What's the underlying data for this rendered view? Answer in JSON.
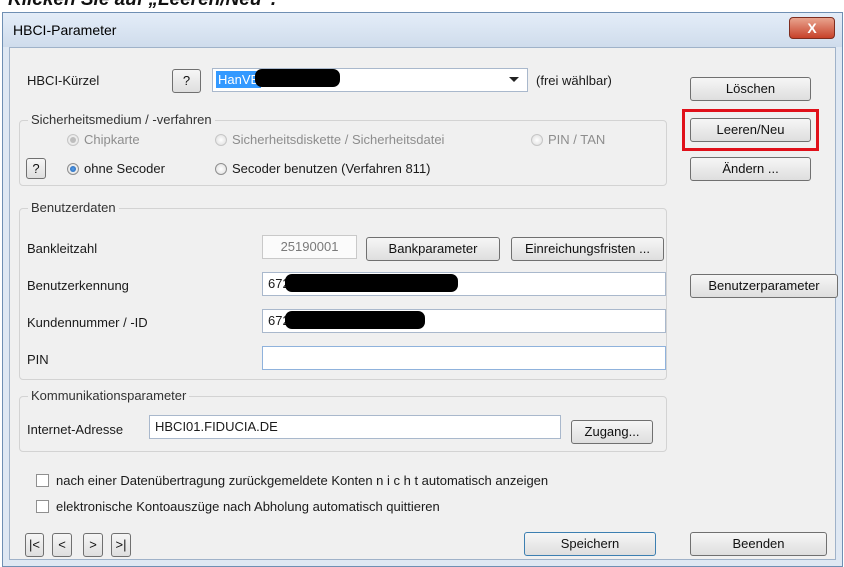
{
  "caption": "Klicken Sie auf „Leeren/Neu“.",
  "window": {
    "title": "HBCI-Parameter",
    "close_label": "X"
  },
  "hbci": {
    "label": "HBCI-Kürzel",
    "help": "?",
    "value": "HanVB",
    "hint": "(frei wählbar)"
  },
  "security": {
    "group_title": "Sicherheitsmedium / -verfahren",
    "opt_chip": "Chipkarte",
    "opt_disk": "Sicherheitsdiskette / Sicherheitsdatei",
    "opt_pin": "PIN / TAN",
    "help": "?",
    "opt_no_secoder": "ohne Secoder",
    "opt_secoder": "Secoder benutzen (Verfahren 811)"
  },
  "user": {
    "group_title": "Benutzerdaten",
    "blz_label": "Bankleitzahl",
    "blz_value": "25190001",
    "bankparam_btn": "Bankparameter",
    "fristen_btn": "Einreichungsfristen ...",
    "kennung_label": "Benutzerkennung",
    "kennung_value": "672",
    "kunde_label": "Kundennummer / -ID",
    "kunde_value": "672",
    "pin_label": "PIN",
    "pin_value": ""
  },
  "comm": {
    "group_title": "Kommunikationsparameter",
    "addr_label": "Internet-Adresse",
    "addr_value": "HBCI01.FIDUCIA.DE",
    "zugang_btn": "Zugang..."
  },
  "options": {
    "no_autoshow": "nach einer Datenübertragung zurückgemeldete Konten  n i c h t  automatisch anzeigen",
    "auto_ack": "elektronische Kontoauszüge nach Abholung automatisch quittieren"
  },
  "side_buttons": {
    "delete": "Löschen",
    "clear_new": "Leeren/Neu",
    "change": "Ändern ...",
    "user_params": "Benutzerparameter"
  },
  "nav": {
    "first": "|<",
    "prev": "<",
    "next": ">",
    "last": ">|"
  },
  "bottom": {
    "save": "Speichern",
    "close": "Beenden"
  }
}
